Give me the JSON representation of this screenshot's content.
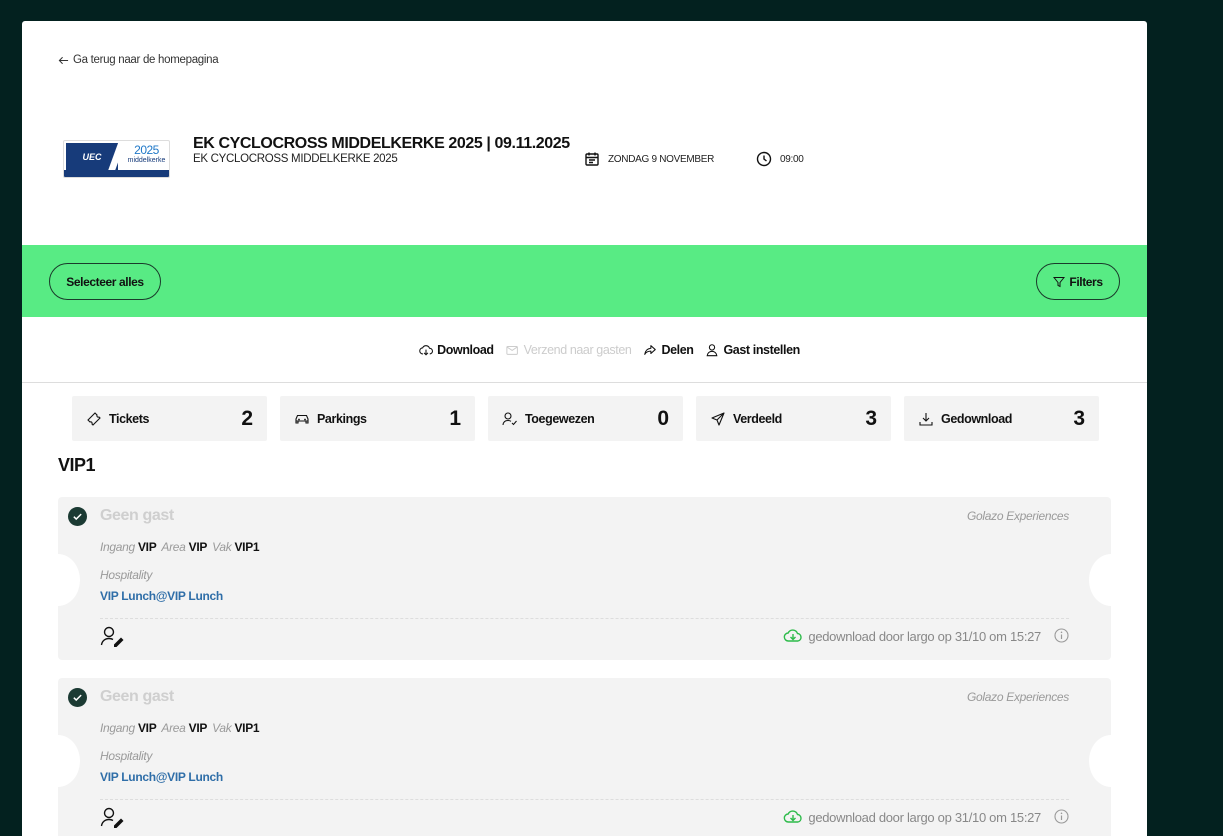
{
  "back_link": "Ga terug naar de homepagina",
  "event": {
    "title": "EK CYCLOCROSS MIDDELKERKE 2025 | 09.11.2025",
    "subtitle": "EK CYCLOCROSS MIDDELKERKE 2025",
    "date": "ZONDAG 9 NOVEMBER",
    "time": "09:00",
    "logo": {
      "brand": "UEC",
      "year": "2025",
      "place": "middelkerke"
    }
  },
  "toolbar": {
    "select_all": "Selecteer alles",
    "filters": "Filters"
  },
  "actions": {
    "download": "Download",
    "send": "Verzend naar gasten",
    "share": "Delen",
    "set_guest": "Gast instellen"
  },
  "stats": [
    {
      "label": "Tickets",
      "value": "2",
      "icon": "ticket-icon"
    },
    {
      "label": "Parkings",
      "value": "1",
      "icon": "car-icon"
    },
    {
      "label": "Toegewezen",
      "value": "0",
      "icon": "user-check-icon"
    },
    {
      "label": "Verdeeld",
      "value": "3",
      "icon": "send-icon"
    },
    {
      "label": "Gedownload",
      "value": "3",
      "icon": "download-icon"
    }
  ],
  "section": "VIP1",
  "tickets": [
    {
      "guest": "Geen gast",
      "organizer": "Golazo Experiences",
      "entrance_label": "Ingang",
      "entrance": "VIP",
      "area_label": "Area",
      "area": "VIP",
      "box_label": "Vak",
      "box": "VIP1",
      "hospitality_label": "Hospitality",
      "hospitality": "VIP Lunch@VIP Lunch",
      "download_status": "gedownload door largo op 31/10 om 15:27"
    },
    {
      "guest": "Geen gast",
      "organizer": "Golazo Experiences",
      "entrance_label": "Ingang",
      "entrance": "VIP",
      "area_label": "Area",
      "area": "VIP",
      "box_label": "Vak",
      "box": "VIP1",
      "hospitality_label": "Hospitality",
      "hospitality": "VIP Lunch@VIP Lunch",
      "download_status": "gedownload door largo op 31/10 om 15:27"
    }
  ],
  "colors": {
    "background": "#03211f",
    "accent_green": "#58eb84",
    "link_blue": "#2f6ea8",
    "download_green": "#2dbb4a"
  }
}
